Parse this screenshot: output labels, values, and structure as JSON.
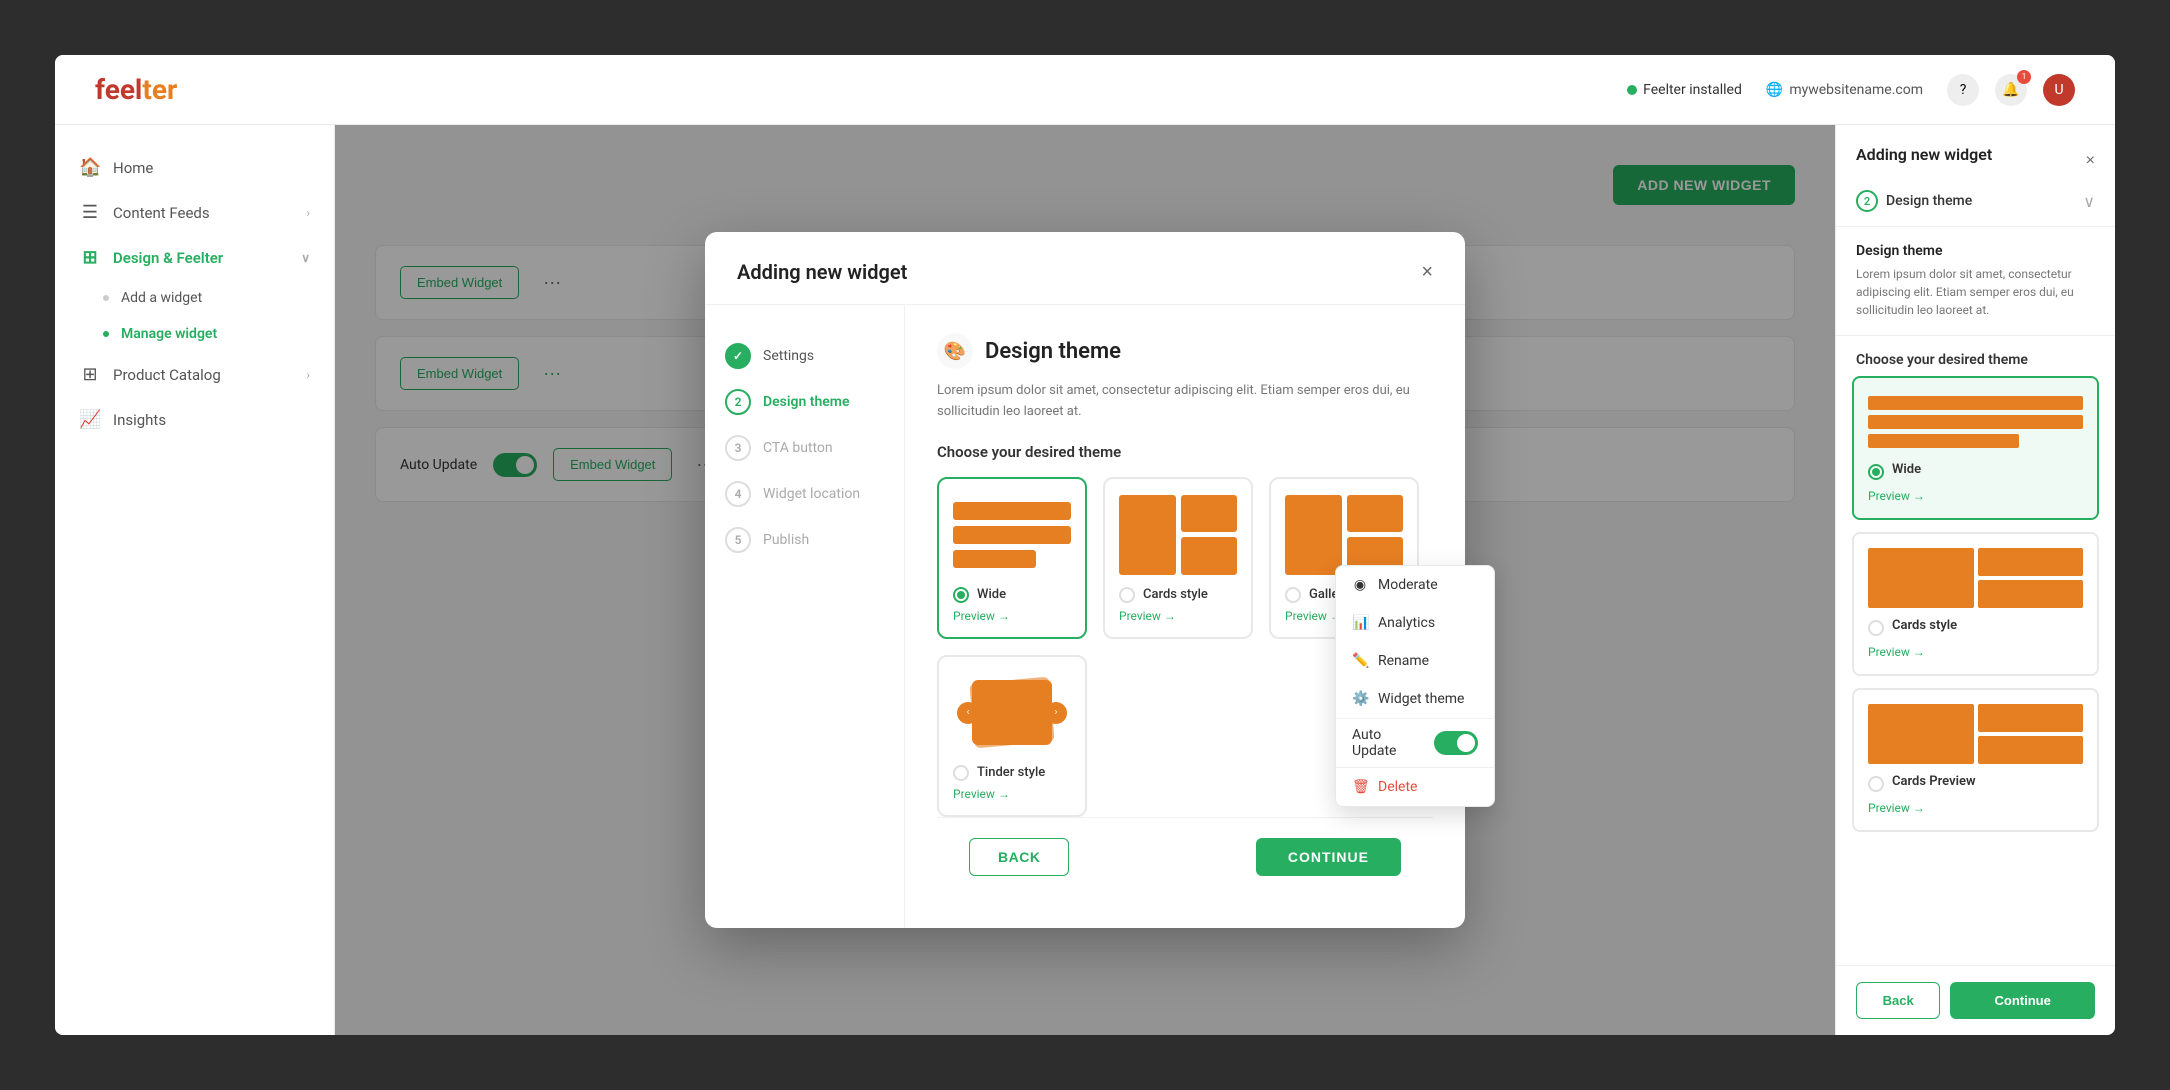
{
  "app": {
    "logo_feel": "feel",
    "logo_ter": "ter",
    "status": "Feelter installed",
    "website": "mywebsitename.com"
  },
  "topnav": {
    "status_label": "Feelter installed",
    "website_label": "mywebsitename.com",
    "help_icon": "?",
    "notification_icon": "🔔",
    "notification_count": "1"
  },
  "sidebar": {
    "items": [
      {
        "id": "home",
        "label": "Home",
        "icon": "🏠",
        "has_chevron": false
      },
      {
        "id": "content-feeds",
        "label": "Content Feeds",
        "icon": "☰",
        "has_chevron": true
      },
      {
        "id": "design-feelter",
        "label": "Design & Feelter",
        "icon": "⊞",
        "has_chevron": true,
        "active": true
      }
    ],
    "sub_items": [
      {
        "id": "add-widget",
        "label": "Add a widget",
        "active": false
      },
      {
        "id": "manage-widget",
        "label": "Manage widget",
        "active": true
      }
    ],
    "bottom_items": [
      {
        "id": "product-catalog",
        "label": "Product Catalog",
        "icon": "⊞",
        "has_chevron": true
      },
      {
        "id": "insights",
        "label": "Insights",
        "icon": "📈"
      }
    ]
  },
  "page": {
    "add_widget_btn": "ADD NEW WIDGET"
  },
  "widget_rows": [
    {
      "embed_label": "Embed Widget",
      "dots": "···"
    },
    {
      "embed_label": "Em",
      "dots": "···"
    },
    {
      "auto_update_label": "Auto Update",
      "embed_label": "Embed Widget",
      "dots": "···"
    }
  ],
  "context_menu": {
    "items": [
      {
        "id": "moderate",
        "label": "Moderate",
        "icon": "◉"
      },
      {
        "id": "analytics",
        "label": "Analytics",
        "icon": "📊"
      },
      {
        "id": "rename",
        "label": "Rename",
        "icon": "✏️"
      },
      {
        "id": "widget-theme",
        "label": "Widget theme",
        "icon": "⚙️"
      },
      {
        "id": "delete",
        "label": "Delete",
        "icon": "🗑",
        "danger": true
      }
    ],
    "auto_update_label": "Auto Update"
  },
  "modal": {
    "title": "Adding new widget",
    "close_icon": "×",
    "steps": [
      {
        "num": "✓",
        "label": "Settings",
        "state": "completed"
      },
      {
        "num": "2",
        "label": "Design theme",
        "state": "active"
      },
      {
        "num": "3",
        "label": "CTA button",
        "state": "inactive"
      },
      {
        "num": "4",
        "label": "Widget location",
        "state": "inactive"
      },
      {
        "num": "5",
        "label": "Publish",
        "state": "inactive"
      }
    ],
    "theme_icon": "🎨",
    "theme_title": "Design theme",
    "theme_desc": "Lorem ipsum dolor sit amet, consectetur adipiscing elit. Etiam semper eros dui, eu sollicitudin leo laoreet at.",
    "choose_label": "Choose your desired theme",
    "themes": [
      {
        "id": "wide",
        "label": "Wide",
        "selected": true,
        "preview_type": "wide"
      },
      {
        "id": "cards",
        "label": "Cards style",
        "selected": false,
        "preview_type": "cards"
      },
      {
        "id": "gallery",
        "label": "Gallery style",
        "selected": false,
        "preview_type": "gallery"
      },
      {
        "id": "tinder",
        "label": "Tinder style",
        "selected": false,
        "preview_type": "tinder"
      }
    ],
    "preview_label": "Preview →",
    "back_label": "BACK",
    "continue_label": "CONTINUE"
  },
  "right_panel": {
    "title": "Adding new widget",
    "close_icon": "×",
    "step_num": "2",
    "step_label": "Design theme",
    "chevron": "∨",
    "section_title": "Design theme",
    "section_desc": "Lorem ipsum dolor sit amet, consectetur adipiscing elit. Etiam semper eros dui, eu sollicitudin leo laoreet at.",
    "choose_label": "Choose your desired theme",
    "themes": [
      {
        "id": "wide",
        "label": "Wide",
        "selected": true,
        "preview_type": "wide"
      },
      {
        "id": "cards",
        "label": "Cards style",
        "selected": false,
        "preview_type": "cards"
      },
      {
        "id": "gallery-preview",
        "label": "Cards Preview",
        "selected": false,
        "preview_type": "gallery"
      }
    ],
    "preview_label": "Preview →",
    "back_label": "Back",
    "continue_label": "Continue"
  }
}
